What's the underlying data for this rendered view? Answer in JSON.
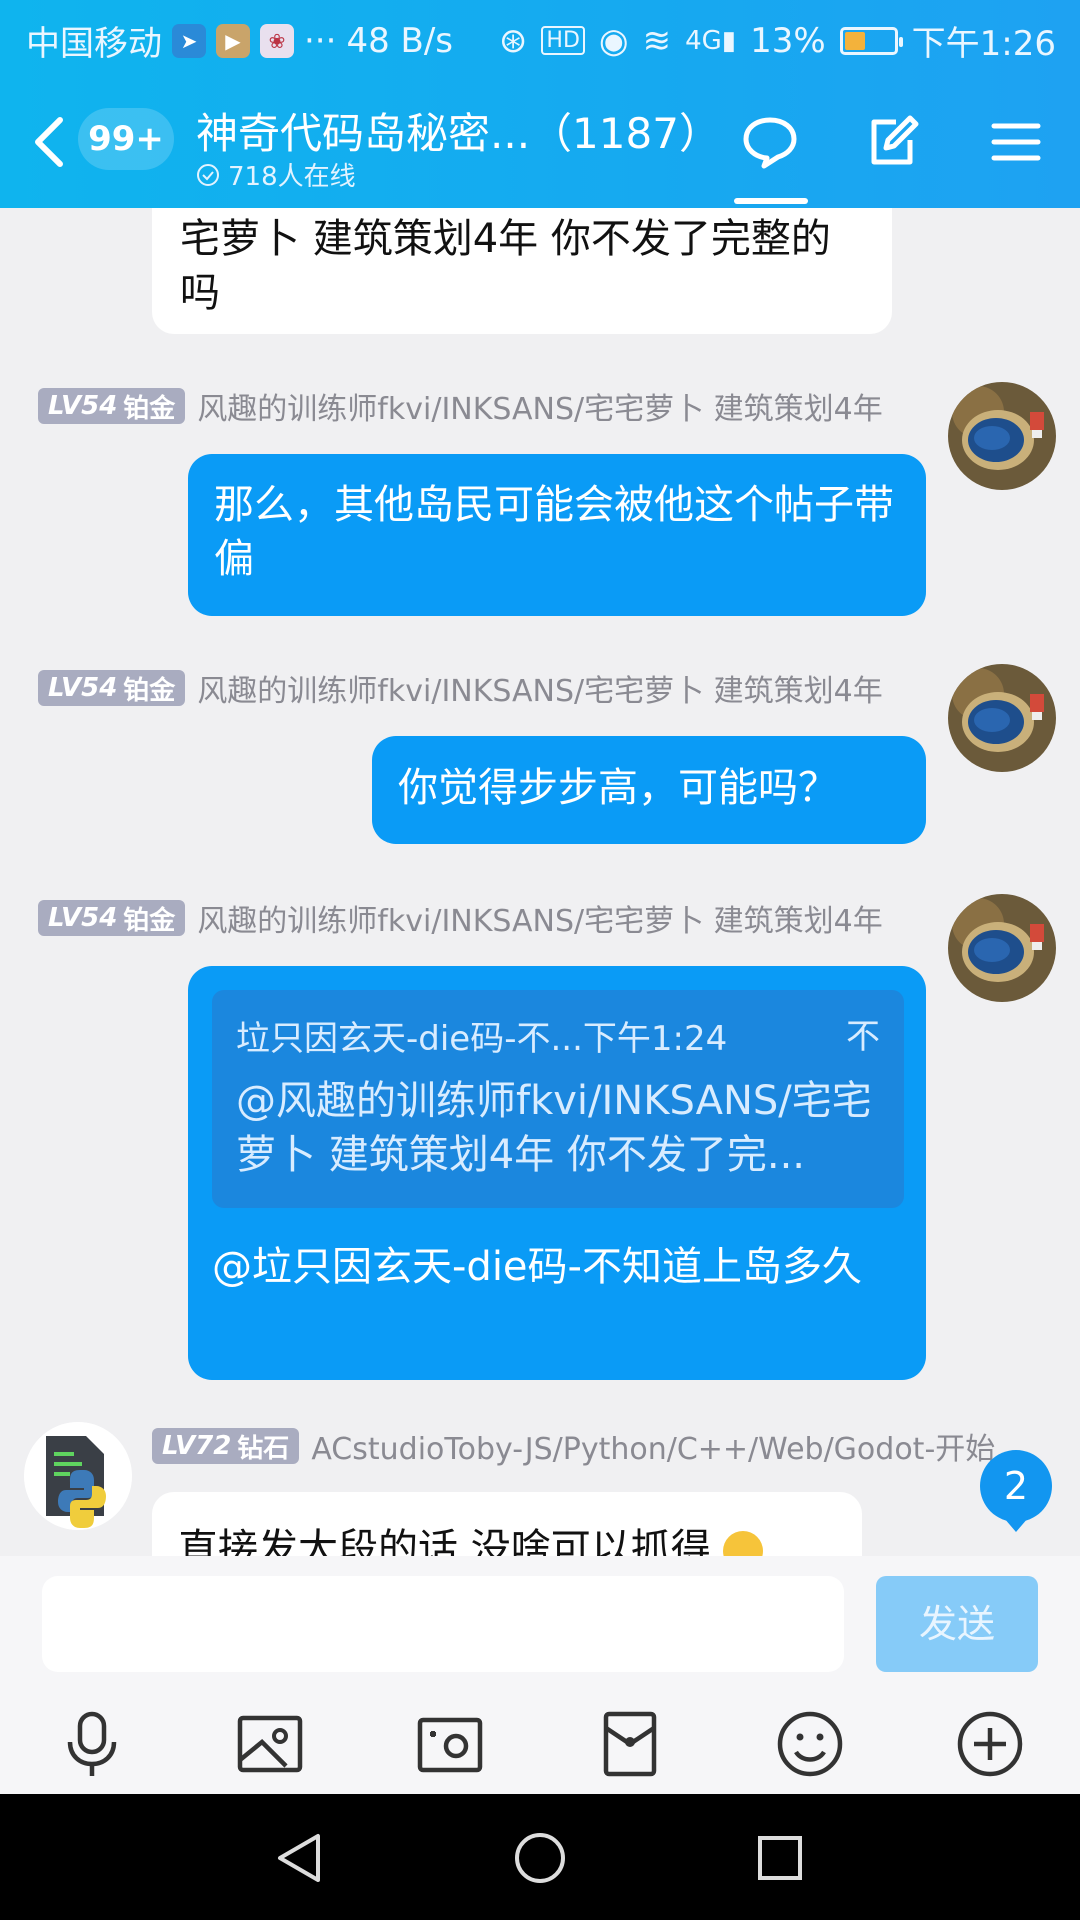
{
  "status_bar": {
    "carrier": "中国移动",
    "net_speed": "48 B/s",
    "battery": "13%",
    "battery_level": 0.13,
    "time": "下午1:26"
  },
  "header": {
    "unread_count": "99+",
    "group_name": "神奇代码岛秘密...（1187）",
    "online_count": "718人在线"
  },
  "messages": [
    {
      "type": "incoming_tail",
      "text": "宅萝卜 建筑策划4年 你不发了完整的吗"
    },
    {
      "type": "outgoing",
      "level": "LV54",
      "rank": "铂金",
      "sender": "风趣的训练师fkvi/INKSANS/宅宅萝卜 建筑策划4年",
      "text": "那么，其他岛民可能会被他这个帖子带偏"
    },
    {
      "type": "outgoing",
      "level": "LV54",
      "rank": "铂金",
      "sender": "风趣的训练师fkvi/INKSANS/宅宅萝卜 建筑策划4年",
      "text": "你觉得步步高，可能吗？"
    },
    {
      "type": "outgoing_reply",
      "level": "LV54",
      "rank": "铂金",
      "sender": "风趣的训练师fkvi/INKSANS/宅宅萝卜 建筑策划4年",
      "quote_head": "垃只因玄天-die码-不...下午1:24",
      "quote_icon": "不",
      "quote_text": "@风趣的训练师fkvi/INKSANS/宅宅萝卜 建筑策划4年 你不发了完...",
      "text": "@垃只因玄天-die码-不知道上岛多久"
    },
    {
      "type": "incoming",
      "level": "LV72",
      "rank": "钻石",
      "sender": "ACstudioToby-JS/Python/C++/Web/Godot-开始...",
      "text": "直接发大段的话 没啥可以抓得"
    }
  ],
  "new_message_badge": "2",
  "input": {
    "placeholder": "",
    "send_label": "发送"
  },
  "toolbar_icons": [
    "microphone-icon",
    "image-icon",
    "camera-icon",
    "red-packet-icon",
    "emoji-icon",
    "plus-icon"
  ],
  "colors": {
    "header_blue": "#16a9f0",
    "bubble_blue": "#0a9bf6",
    "send_disabled": "#86cbf8"
  }
}
